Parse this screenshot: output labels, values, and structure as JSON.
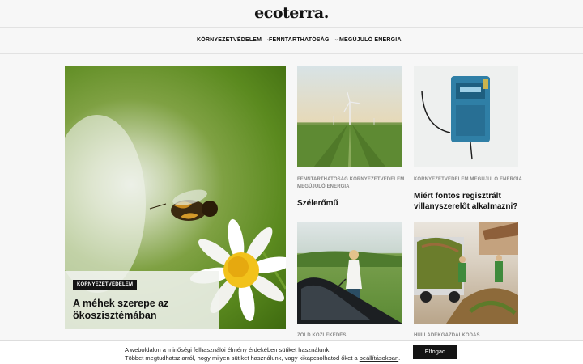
{
  "header": {
    "logo": "ecoterra."
  },
  "nav": {
    "items": [
      {
        "label": "KÖRNYEZETVÉDELEM"
      },
      {
        "label": "FENNTARTHATÓSÁG"
      },
      {
        "label": "MEGÚJULÓ ENERGIA"
      }
    ]
  },
  "feature": {
    "badge": "KÖRNYEZETVÉDELEM",
    "title": "A méhek szerepe az ökoszisztémában",
    "image": "bee-on-daisy-image"
  },
  "cards": [
    {
      "cats1": "FENNTARTHATÓSÁG KÖRNYEZETVÉDELEM",
      "cats2": "MEGÚJULÓ ENERGIA",
      "title": "Szélerőmű",
      "image": "wind-turbine-image"
    },
    {
      "cats1": "KÖRNYEZETVÉDELEM MEGÚJULÓ ENERGIA",
      "cats2": "",
      "title": "Miért fontos regisztrált villanyszerelőt alkalmazni?",
      "image": "electric-meter-image"
    },
    {
      "cats1": "ZÖLD KÖZLEKEDÉS",
      "cats2": "",
      "title": "",
      "image": "woman-charging-car-image"
    },
    {
      "cats1": "HULLADÉKGAZDÁLKODÁS",
      "cats2": "",
      "title": "",
      "image": "green-waste-truck-image"
    }
  ],
  "cookie": {
    "line1": "A weboldalon a minőségi felhasználói élmény érdekében sütiket használunk.",
    "line2_prefix": "Többet megtudhatsz arról, hogy milyen sütiket használunk, vagy kikapcsolhatod őket a ",
    "link": "beállításokban",
    "line2_suffix": ".",
    "accept": "Elfogad"
  }
}
